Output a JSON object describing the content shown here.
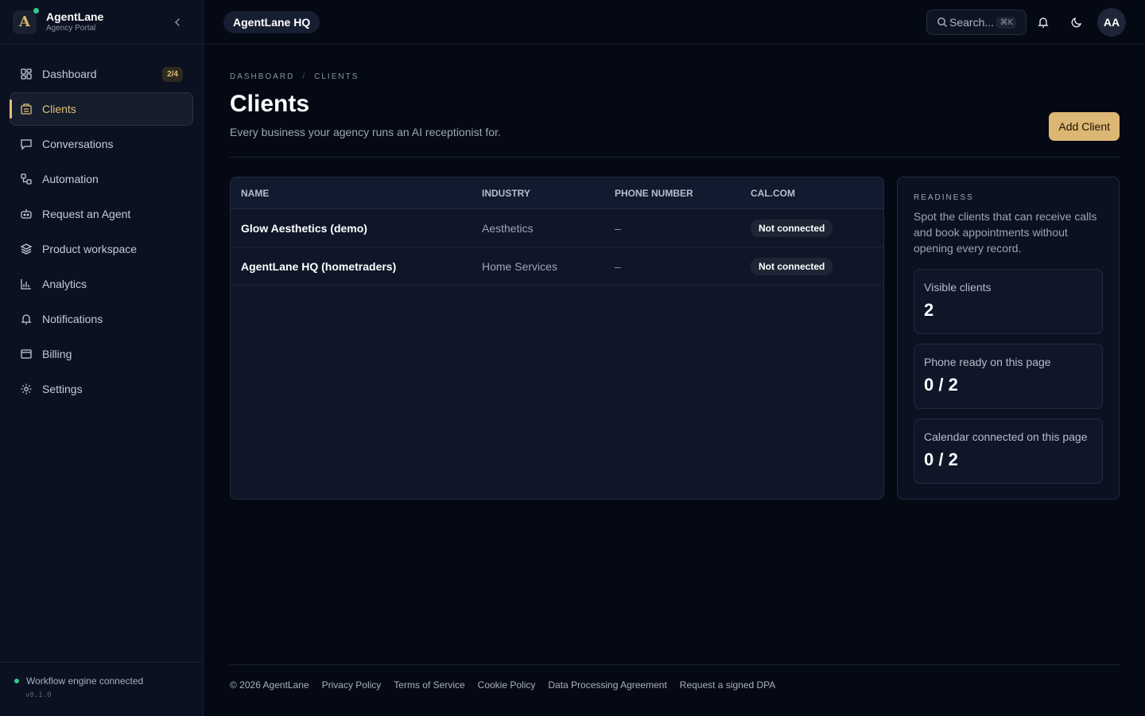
{
  "brand": {
    "name": "AgentLane",
    "subtitle": "Agency Portal",
    "logo_letter": "A"
  },
  "sidebar": {
    "items": [
      {
        "label": "Dashboard",
        "icon": "dashboard-icon",
        "badge": "2/4"
      },
      {
        "label": "Clients",
        "icon": "clients-icon",
        "active": true
      },
      {
        "label": "Conversations",
        "icon": "chat-icon"
      },
      {
        "label": "Automation",
        "icon": "automation-icon"
      },
      {
        "label": "Request an Agent",
        "icon": "bot-icon"
      },
      {
        "label": "Product workspace",
        "icon": "layers-icon"
      },
      {
        "label": "Analytics",
        "icon": "bar-chart-icon"
      },
      {
        "label": "Notifications",
        "icon": "bell-icon"
      },
      {
        "label": "Billing",
        "icon": "credit-card-icon"
      },
      {
        "label": "Settings",
        "icon": "gear-icon"
      }
    ],
    "footer": {
      "status": "Workflow engine connected",
      "version": "v0.1.0"
    }
  },
  "topbar": {
    "workspace": "AgentLane HQ",
    "search_placeholder": "Search...",
    "search_shortcut": "⌘K",
    "avatar_initials": "AA"
  },
  "page": {
    "breadcrumb": [
      "DASHBOARD",
      "CLIENTS"
    ],
    "title": "Clients",
    "subtitle": "Every business your agency runs an AI receptionist for.",
    "add_button": "Add Client"
  },
  "table": {
    "headers": [
      "NAME",
      "INDUSTRY",
      "PHONE NUMBER",
      "CAL.COM"
    ],
    "rows": [
      {
        "name": "Glow Aesthetics (demo)",
        "industry": "Aesthetics",
        "phone": "–",
        "cal": "Not connected"
      },
      {
        "name": "AgentLane HQ (hometraders)",
        "industry": "Home Services",
        "phone": "–",
        "cal": "Not connected"
      }
    ]
  },
  "readiness": {
    "title": "READINESS",
    "description": "Spot the clients that can receive calls and book appointments without opening every record.",
    "stats": [
      {
        "label": "Visible clients",
        "value": "2"
      },
      {
        "label": "Phone ready on this page",
        "value": "0 / 2"
      },
      {
        "label": "Calendar connected on this page",
        "value": "0 / 2"
      }
    ]
  },
  "footer": {
    "copyright": "© 2026 AgentLane",
    "links": [
      "Privacy Policy",
      "Terms of Service",
      "Cookie Policy",
      "Data Processing Agreement",
      "Request a signed DPA"
    ]
  },
  "colors": {
    "accent": "#dcb773",
    "background": "#050914",
    "sidebar": "#0b1120",
    "status_green": "#34c98a"
  }
}
